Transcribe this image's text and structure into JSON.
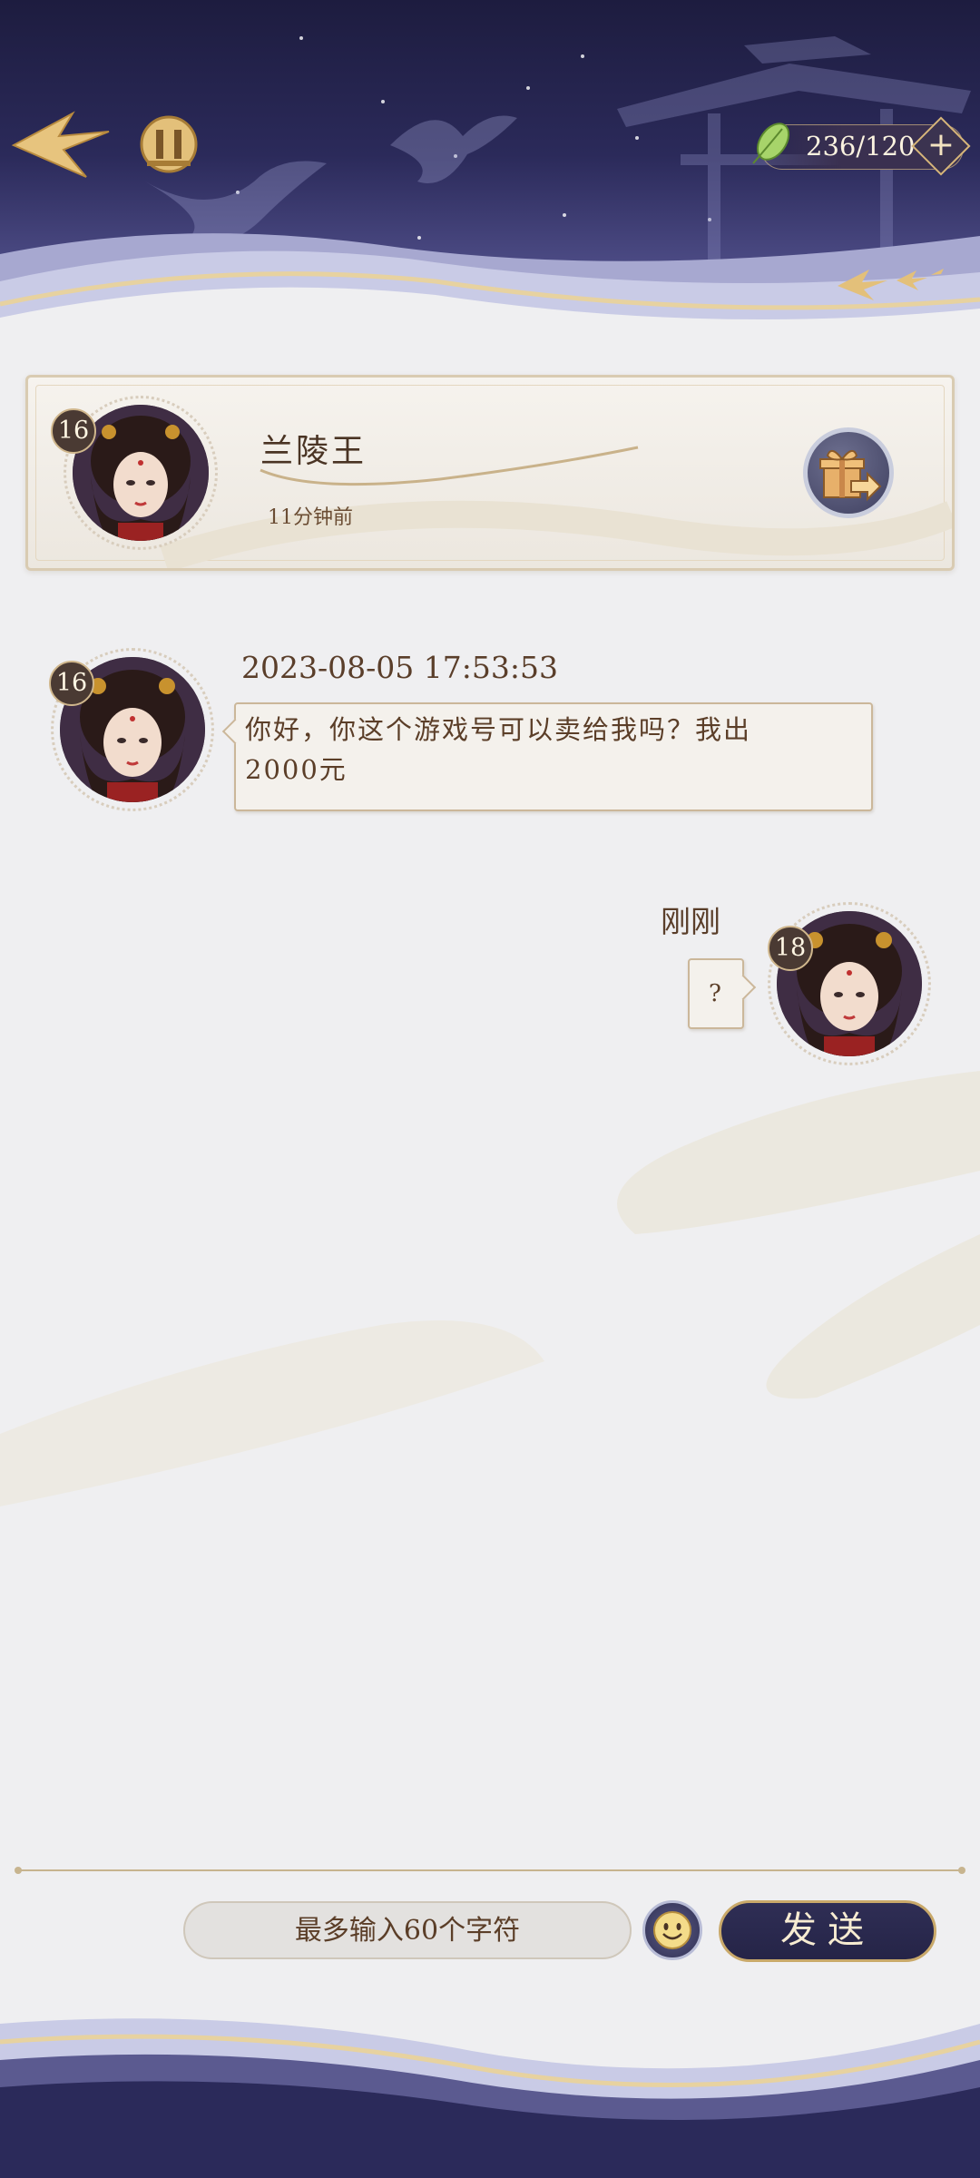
{
  "header": {
    "stamina": "236/120",
    "plus_label": "+"
  },
  "contact": {
    "name": "兰陵王",
    "last_seen": "11分钟前",
    "level": "16"
  },
  "messages": [
    {
      "side": "left",
      "time": "2023-08-05 17:53:53",
      "level": "16",
      "text_line1": "你好，你这个游戏号可以卖给我吗？我出",
      "text_line2": "2000元"
    },
    {
      "side": "right",
      "time": "刚刚",
      "level": "18",
      "text": "?"
    }
  ],
  "composer": {
    "placeholder": "最多输入60个字符",
    "send_label": "发送"
  },
  "colors": {
    "header_navy": "#2b2a5a",
    "gold": "#c9a96a",
    "bubble_bg": "#f4f1ec",
    "text_brown": "#4a3424"
  }
}
